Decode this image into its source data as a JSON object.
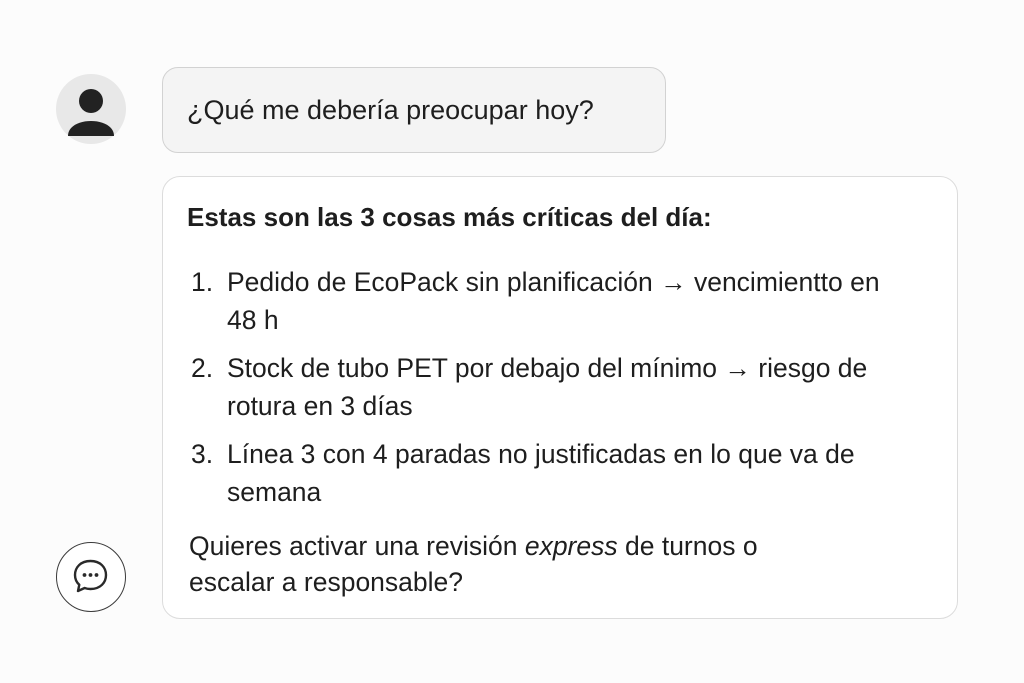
{
  "user_message": {
    "avatar_icon": "user-icon",
    "text": "¿Qué me debería preocupar hoy?"
  },
  "assistant_message": {
    "icon": "chat-bubble-icon",
    "heading": "Estas son las 3 cosas más críticas del día:",
    "items": [
      {
        "number": "1.",
        "text": "Pedido de EcoPack sin planificación → vencimientto en 48 h"
      },
      {
        "number": "2.",
        "text": "Stock de tubo PET por debajo del mínimo → riesgo de rotura en 3 días"
      },
      {
        "number": "3.",
        "text": "Línea 3 con 4 paradas no justificadas en lo que va de semana"
      }
    ],
    "question_prefix": "Quieres activar una revisión ",
    "question_emphasis": "express",
    "question_suffix": " de turnos o escalar a responsable?"
  },
  "colors": {
    "page_background": "#fcfcfc",
    "user_bubble": "#f4f4f4",
    "avatar_background": "#e8e8e8",
    "avatar_figure": "#222222",
    "text": "#1e1e1e"
  }
}
